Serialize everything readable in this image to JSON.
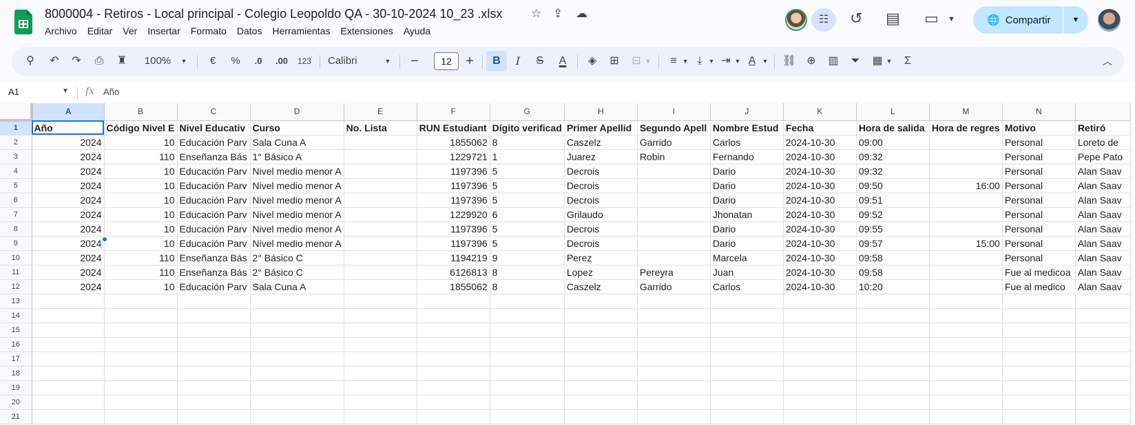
{
  "title_bar": {
    "doc_title": "8000004 - Retiros - Local principal - Colegio Leopoldo QA - 30-10-2024 10_23 .xlsx",
    "share_label": "Compartir"
  },
  "menu": [
    "Archivo",
    "Editar",
    "Ver",
    "Insertar",
    "Formato",
    "Datos",
    "Herramientas",
    "Extensiones",
    "Ayuda"
  ],
  "toolbar": {
    "zoom": "100%",
    "currency": "€",
    "percent": "%",
    "dec_decrease": ".0",
    "dec_increase": ".00",
    "number_format": "123",
    "font_name": "Calibri",
    "font_size": "12",
    "bold": "B",
    "italic": "I",
    "strike": "S",
    "text_color": "A",
    "function": "Σ"
  },
  "formula_bar": {
    "cell_ref": "A1",
    "fx": "fx",
    "content": "Año"
  },
  "grid": {
    "columns": [
      "A",
      "B",
      "C",
      "D",
      "E",
      "F",
      "G",
      "H",
      "I",
      "J",
      "K",
      "L",
      "M",
      "N",
      ""
    ],
    "header_cells": [
      "Año",
      "Código Nivel E",
      "Nivel Educativ",
      "Curso",
      "No. Lista",
      "RUN Estudiant",
      "Dígito verificad",
      "Primer Apellid",
      "Segundo Apell",
      "Nombre Estud",
      "Fecha",
      "Hora de salida",
      "Hora de regres",
      "Motivo",
      "Retiró"
    ],
    "rows": [
      [
        "2024",
        "10",
        "Educación Parv",
        "Sala Cuna A",
        "",
        "1855062",
        "8",
        "Caszelz",
        "Garrido",
        "Carlos",
        "2024-10-30",
        "09:00",
        "",
        "Personal",
        "Loreto de"
      ],
      [
        "2024",
        "110",
        "Enseñanza Bás",
        "1° Básico A",
        "",
        "1229721",
        "1",
        "Juarez",
        "Robin",
        "Fernando",
        "2024-10-30",
        "09:32",
        "",
        "Personal",
        "Pepe Pato"
      ],
      [
        "2024",
        "10",
        "Educación Parv",
        "Nivel medio menor A",
        "",
        "1197396",
        "5",
        "Decrois",
        "",
        "Dario",
        "2024-10-30",
        "09:32",
        "",
        "Personal",
        "Alan Saav"
      ],
      [
        "2024",
        "10",
        "Educación Parv",
        "Nivel medio menor A",
        "",
        "1197396",
        "5",
        "Decrois",
        "",
        "Dario",
        "2024-10-30",
        "09:50",
        "16:00",
        "Personal",
        "Alan Saav"
      ],
      [
        "2024",
        "10",
        "Educación Parv",
        "Nivel medio menor A",
        "",
        "1197396",
        "5",
        "Decrois",
        "",
        "Dario",
        "2024-10-30",
        "09:51",
        "",
        "Personal",
        "Alan Saav"
      ],
      [
        "2024",
        "10",
        "Educación Parv",
        "Nivel medio menor A",
        "",
        "1229920",
        "6",
        "Grilaudo",
        "",
        "Jhonatan",
        "2024-10-30",
        "09:52",
        "",
        "Personal",
        "Alan Saav"
      ],
      [
        "2024",
        "10",
        "Educación Parv",
        "Nivel medio menor A",
        "",
        "1197396",
        "5",
        "Decrois",
        "",
        "Dario",
        "2024-10-30",
        "09:55",
        "",
        "Personal",
        "Alan Saav"
      ],
      [
        "2024",
        "10",
        "Educación Parv",
        "Nivel medio menor A",
        "",
        "1197396",
        "5",
        "Decrois",
        "",
        "Dario",
        "2024-10-30",
        "09:57",
        "15:00",
        "Personal",
        "Alan Saav"
      ],
      [
        "2024",
        "110",
        "Enseñanza Bás",
        "2° Básico C",
        "",
        "1194219",
        "9",
        "Perez",
        "",
        "Marcela",
        "2024-10-30",
        "09:58",
        "",
        "Personal",
        "Alan Saav"
      ],
      [
        "2024",
        "110",
        "Enseñanza Bás",
        "2° Básico C",
        "",
        "6126813",
        "8",
        "Lopez",
        "Pereyra",
        "Juan",
        "2024-10-30",
        "09:58",
        "",
        "Fue al medicoa",
        "Alan Saav"
      ],
      [
        "2024",
        "10",
        "Educación Parv",
        "Sala Cuna A",
        "",
        "1855062",
        "8",
        "Caszelz",
        "Garrido",
        "Carlos",
        "2024-10-30",
        "10:20",
        "",
        "Fue al medico",
        "Alan Saav"
      ]
    ],
    "row_numbers": [
      "1",
      "2",
      "3",
      "4",
      "5",
      "6",
      "7",
      "8",
      "9",
      "10",
      "11",
      "12",
      "13",
      "14",
      "15",
      "16",
      "17",
      "18",
      "19",
      "20",
      "21"
    ]
  }
}
